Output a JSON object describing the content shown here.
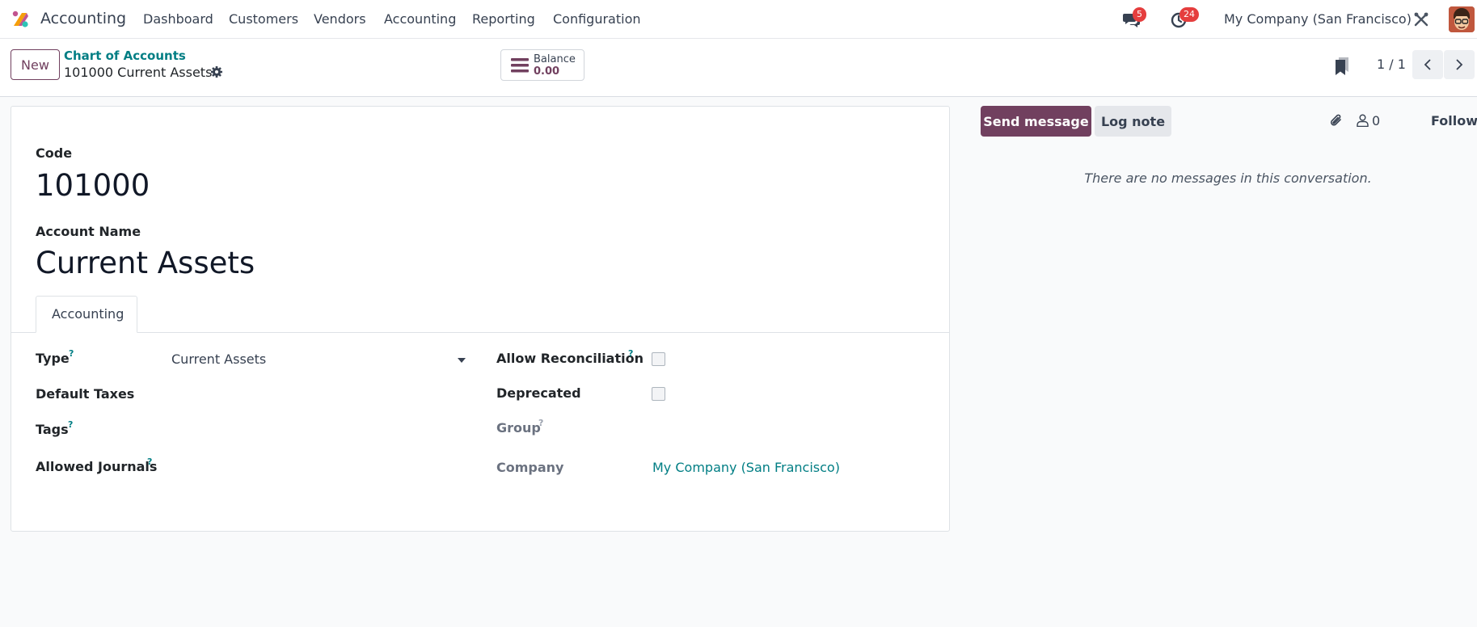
{
  "navbar": {
    "app_name": "Accounting",
    "menu": [
      "Dashboard",
      "Customers",
      "Vendors",
      "Accounting",
      "Reporting",
      "Configuration"
    ],
    "messages_badge": "5",
    "activities_badge": "24",
    "company": "My Company (San Francisco)",
    "icons": [
      "app-logo-icon",
      "chat-bubbles-icon",
      "clock-icon",
      "debug-tools-icon",
      "user-avatar"
    ],
    "colors": {
      "badge": "#e53e3e",
      "brand": "#71405f"
    }
  },
  "control_panel": {
    "new_label": "New",
    "breadcrumb_parent": "Chart of Accounts",
    "breadcrumb_current": "101000 Current Assets",
    "smart_button": {
      "label": "Balance",
      "value": "0.00"
    },
    "pager": "1 / 1"
  },
  "form": {
    "code_label": "Code",
    "code_value": "101000",
    "name_label": "Account Name",
    "name_value": "Current Assets",
    "tab_label": "Accounting",
    "left_fields": {
      "type_label": "Type",
      "type_value": "Current Assets",
      "default_taxes_label": "Default Taxes",
      "tags_label": "Tags",
      "allowed_journals_label": "Allowed Journals"
    },
    "right_fields": {
      "allow_reconciliation_label": "Allow Reconciliation",
      "allow_reconciliation_checked": false,
      "deprecated_label": "Deprecated",
      "deprecated_checked": false,
      "group_label": "Group",
      "company_label": "Company",
      "company_value": "My Company (San Francisco)"
    },
    "help_mark": "?"
  },
  "chatter": {
    "send_message_label": "Send message",
    "log_note_label": "Log note",
    "followers_count": "0",
    "follow_label": "Follow",
    "empty_message": "There are no messages in this conversation."
  }
}
